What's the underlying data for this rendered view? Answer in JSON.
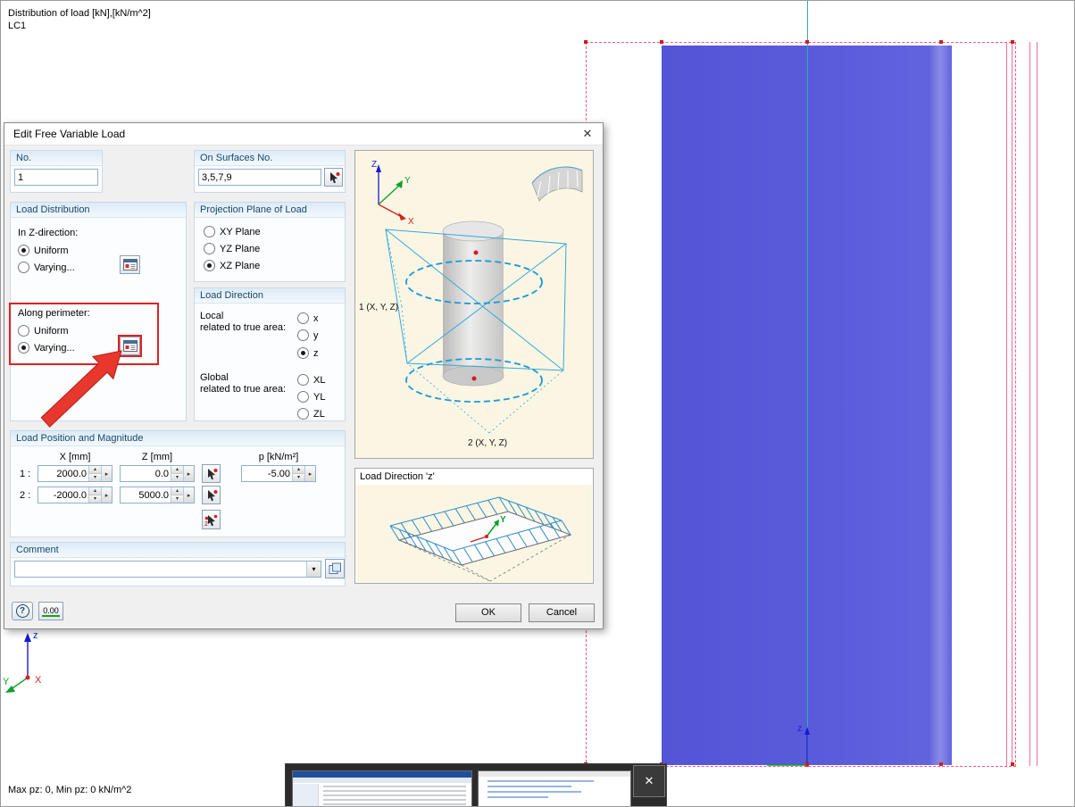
{
  "canvas": {
    "header": "Distribution of load [kN],[kN/m^2]",
    "load_case": "LC1",
    "status": "Max pz: 0, Min pz: 0 kN/m^2",
    "axes": {
      "z": "z",
      "y": "Y",
      "x": "X"
    },
    "grid_axis_z": "z"
  },
  "taskbar": {
    "close_icon": "✕"
  },
  "icons": {
    "close": "✕",
    "spin_up": "▴",
    "spin_down": "▾",
    "spin_side": "▸",
    "dropdown": "▾",
    "help": "?",
    "pick_two": "2"
  },
  "dialog": {
    "title": "Edit Free Variable Load",
    "no": {
      "title": "No.",
      "value": "1"
    },
    "surfaces": {
      "title": "On Surfaces No.",
      "value": "3,5,7,9"
    },
    "distribution": {
      "title": "Load Distribution",
      "z_direction_label": "In Z-direction:",
      "uniform": "Uniform",
      "varying": "Varying...",
      "perimeter_label": "Along perimeter:",
      "perimeter_uniform": "Uniform",
      "perimeter_varying": "Varying..."
    },
    "projection": {
      "title": "Projection Plane of Load",
      "opts": [
        "XY Plane",
        "YZ Plane",
        "XZ Plane"
      ]
    },
    "direction": {
      "title": "Load Direction",
      "local_label": "Local",
      "local_sub": "related to true area:",
      "global_label": "Global",
      "global_sub": "related to true area:",
      "local_opts": [
        "x",
        "y",
        "z"
      ],
      "global_opts": [
        "XL",
        "YL",
        "ZL"
      ]
    },
    "position": {
      "title": "Load Position and Magnitude",
      "col_x": "X [mm]",
      "col_z": "Z [mm]",
      "col_p": "p [kN/m²]",
      "rows": [
        {
          "label": "1 :",
          "x": "2000.0",
          "z": "0.0",
          "p": "-5.00"
        },
        {
          "label": "2 :",
          "x": "-2000.0",
          "z": "5000.0"
        }
      ]
    },
    "comment": {
      "title": "Comment",
      "value": ""
    },
    "preview": {
      "axis_z": "Z",
      "axis_y": "Y",
      "axis_x": "X",
      "point1": "1 (X, Y, Z)",
      "point2": "2 (X, Y, Z)"
    },
    "direction_preview": {
      "label": "Load Direction 'z'",
      "axis_y": "Y"
    },
    "buttons": {
      "ok": "OK",
      "cancel": "Cancel",
      "units": "0.00"
    }
  }
}
